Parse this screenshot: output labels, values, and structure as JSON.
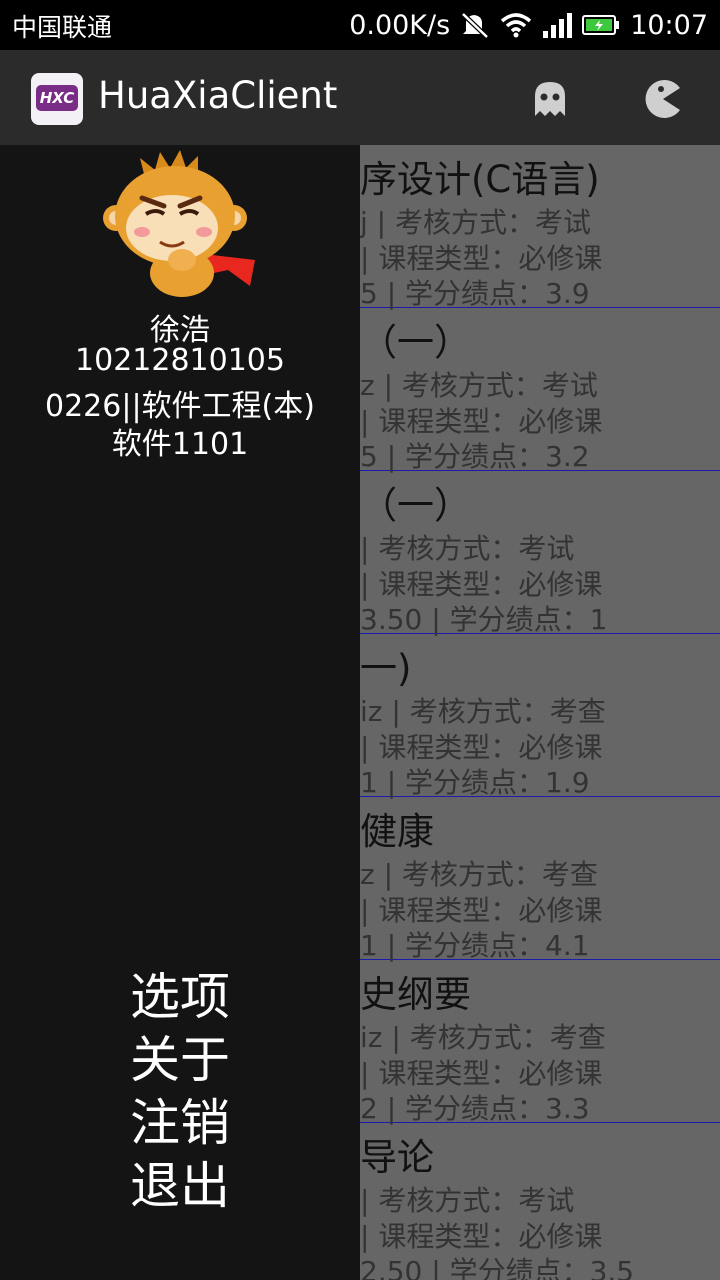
{
  "status_bar": {
    "carrier": "中国联通",
    "speed": "0.00K/s",
    "time": "10:07",
    "icons": [
      "mute-icon",
      "wifi-icon",
      "signal-icon",
      "battery-icon"
    ]
  },
  "action_bar": {
    "logo_text": "HXC",
    "title": "HuaXiaClient",
    "actions": [
      "ghost-icon",
      "pacman-icon"
    ]
  },
  "drawer": {
    "user_name": "徐浩",
    "student_id": "10212810105",
    "major": "0226||软件工程(本)",
    "class_name": "软件1101",
    "menu": [
      "选项",
      "关于",
      "注销",
      "退出"
    ]
  },
  "courses": [
    {
      "name": "序设计(C语言)",
      "line1": "j | 考核方式：考试",
      "line2": "| 课程类型：必修课",
      "line3": "5 | 学分绩点：3.9"
    },
    {
      "name": "（一）",
      "line1": "z | 考核方式：考试",
      "line2": "| 课程类型：必修课",
      "line3": "5 | 学分绩点：3.2"
    },
    {
      "name": "（一）",
      "line1": "| 考核方式：考试",
      "line2": "| 课程类型：必修课",
      "line3": "3.50 | 学分绩点：1"
    },
    {
      "name": "一)",
      "line1": "iz | 考核方式：考查",
      "line2": "| 课程类型：必修课",
      "line3": "1 | 学分绩点：1.9"
    },
    {
      "name": "健康",
      "line1": "z | 考核方式：考查",
      "line2": "| 课程类型：必修课",
      "line3": "1 | 学分绩点：4.1"
    },
    {
      "name": "史纲要",
      "line1": "iz | 考核方式：考查",
      "line2": "| 课程类型：必修课",
      "line3": "2 | 学分绩点：3.3"
    },
    {
      "name": "导论",
      "line1": "| 考核方式：考试",
      "line2": "| 课程类型：必修课",
      "line3": "2.50 | 学分绩点：3.5"
    }
  ],
  "colors": {
    "status_bar_bg": "#000000",
    "action_bar_bg": "#2b2b2b",
    "drawer_bg": "#141414",
    "content_dim_bg": "#666666",
    "divider": "#1b1bb0",
    "logo_accent": "#7a2d86"
  }
}
